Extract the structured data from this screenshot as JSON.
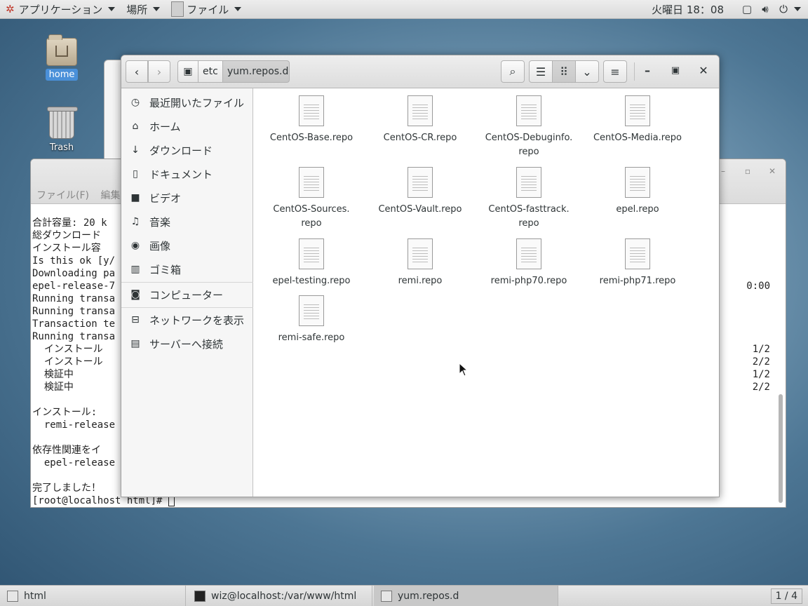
{
  "topbar": {
    "applications": "アプリケーション",
    "places": "場所",
    "current_app": "ファイル",
    "clock": "火曜日 18：08"
  },
  "desktop": {
    "home_label": "home",
    "trash_label": "Trash"
  },
  "terminal": {
    "menu": [
      "ファイル(F)",
      "編集"
    ],
    "lines": [
      "合計容量: 20 k",
      "総ダウンロード",
      "インストール容",
      "Is this ok [y/",
      "Downloading pa",
      "epel-release-7",
      "Running transa",
      "Running transa",
      "Transaction te",
      "Running transa",
      "  インストール",
      "  インストール",
      "  検証中",
      "  検証中",
      "",
      "インストール:",
      "  remi-release",
      "",
      "依存性関連をイ",
      "  epel-release",
      "",
      "完了しました！"
    ],
    "prompt": "[root@localhost html]# ",
    "right_time": "0:00",
    "progress": [
      "1/2",
      "2/2",
      "1/2",
      "2/2"
    ]
  },
  "nautilus": {
    "path": [
      "etc",
      "yum.repos.d"
    ],
    "sidebar": [
      {
        "icon": "clock-icon",
        "glyph": "◷",
        "label": "最近開いたファイル"
      },
      {
        "icon": "home-icon",
        "glyph": "⌂",
        "label": "ホーム"
      },
      {
        "icon": "download-icon",
        "glyph": "↓",
        "label": "ダウンロード"
      },
      {
        "icon": "document-icon",
        "glyph": "▯",
        "label": "ドキュメント"
      },
      {
        "icon": "video-icon",
        "glyph": "■",
        "label": "ビデオ"
      },
      {
        "icon": "music-icon",
        "glyph": "♫",
        "label": "音楽"
      },
      {
        "icon": "camera-icon",
        "glyph": "◉",
        "label": "画像"
      },
      {
        "icon": "trash-icon",
        "glyph": "▥",
        "label": "ゴミ箱"
      },
      {
        "icon": "computer-icon",
        "glyph": "◙",
        "label": "コンピューター"
      },
      {
        "icon": "network-icon",
        "glyph": "⊟",
        "label": "ネットワークを表示"
      },
      {
        "icon": "server-icon",
        "glyph": "▤",
        "label": "サーバーへ接続"
      }
    ],
    "files": [
      {
        "line1": "CentOS-Base.repo",
        "line2": ""
      },
      {
        "line1": "CentOS-CR.repo",
        "line2": ""
      },
      {
        "line1": "CentOS-Debuginfo.",
        "line2": "repo"
      },
      {
        "line1": "CentOS-Media.repo",
        "line2": ""
      },
      {
        "line1": "CentOS-Sources.",
        "line2": "repo"
      },
      {
        "line1": "CentOS-Vault.repo",
        "line2": ""
      },
      {
        "line1": "CentOS-fasttrack.",
        "line2": "repo"
      },
      {
        "line1": "epel.repo",
        "line2": ""
      },
      {
        "line1": "epel-testing.repo",
        "line2": ""
      },
      {
        "line1": "remi.repo",
        "line2": ""
      },
      {
        "line1": "remi-php70.repo",
        "line2": ""
      },
      {
        "line1": "remi-php71.repo",
        "line2": ""
      },
      {
        "line1": "remi-safe.repo",
        "line2": ""
      }
    ]
  },
  "taskbar": {
    "tasks": [
      "html",
      "wiz@localhost:/var/www/html",
      "yum.repos.d"
    ],
    "pager": "1 / 4"
  }
}
